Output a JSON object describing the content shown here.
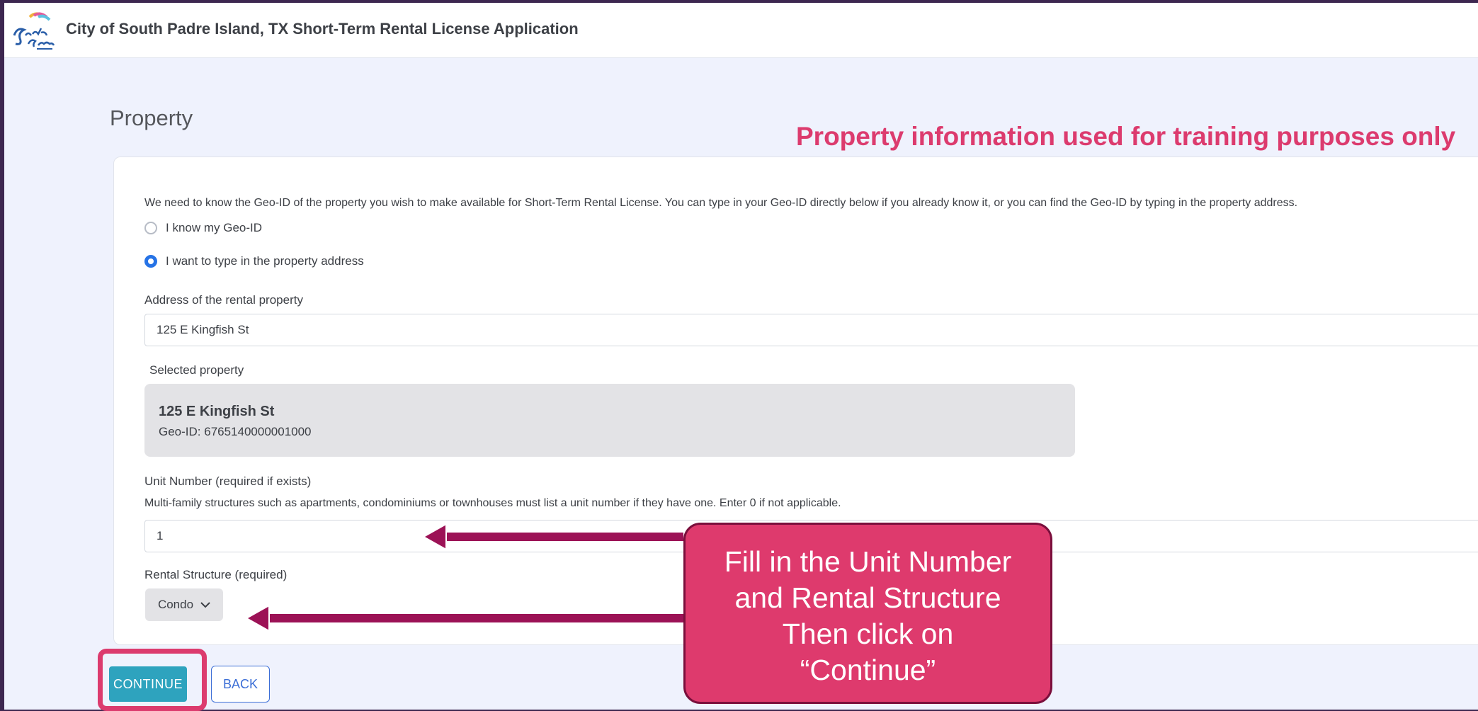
{
  "header": {
    "title": "City of South Padre Island, TX Short-Term Rental License Application"
  },
  "page": {
    "section_title": "Property",
    "training_note": "Property information used for training purposes only"
  },
  "form": {
    "intro": "We need to know the Geo-ID of the property you wish to make available for Short-Term Rental License. You can type in your Geo-ID directly below if you already know it, or you can find the Geo-ID by typing in the property address.",
    "radio_options": [
      {
        "label": "I know my Geo-ID",
        "selected": false
      },
      {
        "label": "I want to type in the property address",
        "selected": true
      }
    ],
    "address_label": "Address of the rental property",
    "address_value": "125 E Kingfish St",
    "selected_property_label": "Selected property",
    "selected_property": {
      "name": "125 E Kingfish St",
      "geo_id": "Geo-ID: 6765140000001000"
    },
    "unit_label": "Unit Number (required if exists)",
    "unit_help": "Multi-family structures such as apartments, condominiums or townhouses must list a unit number if they have one. Enter 0 if not applicable.",
    "unit_value": "1",
    "structure_label": "Rental Structure (required)",
    "structure_value": "Condo"
  },
  "buttons": {
    "continue_label": "CONTINUE",
    "back_label": "BACK"
  },
  "annotation": {
    "callout_lines": [
      "Fill in the Unit Number",
      "and Rental Structure",
      "Then click on",
      "“Continue”"
    ]
  },
  "colors": {
    "accent_pink": "#dc3b6e",
    "arrow": "#9c1256",
    "continue_button": "#2ea3be",
    "back_button": "#3b6ed6",
    "radio_selected": "#2673e6"
  },
  "icons": {
    "logo": "south-padre-island-logo",
    "select_chevron": "chevron-down-icon"
  }
}
